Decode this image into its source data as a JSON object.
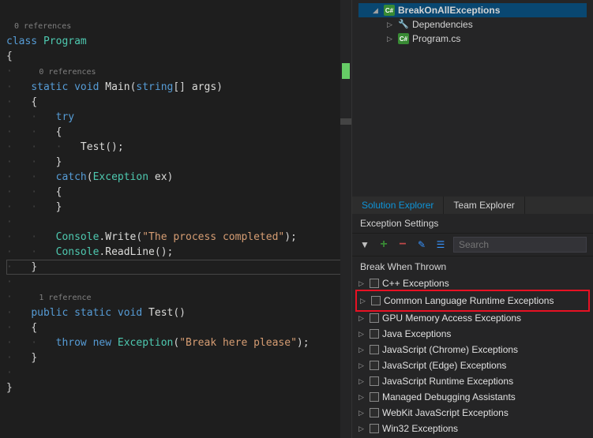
{
  "editor": {
    "codelens_class": "0 references",
    "codelens_main": "0 references",
    "codelens_test": "1 reference",
    "tokens": {
      "class": "class",
      "program": "Program",
      "static": "static",
      "void": "void",
      "main": "Main",
      "string_arr": "string",
      "args": "args",
      "try": "try",
      "test_call": "Test",
      "catch": "catch",
      "exception": "Exception",
      "ex": "ex",
      "console": "Console",
      "write": "Write",
      "readline": "ReadLine",
      "str1": "\"The process completed\"",
      "public": "public",
      "test": "Test",
      "throw": "throw",
      "new": "new",
      "str2": "\"Break here please\""
    }
  },
  "solution": {
    "project": "BreakOnAllExceptions",
    "deps": "Dependencies",
    "file1": "Program.cs",
    "cs_badge": "C#"
  },
  "tabs": {
    "solution_explorer": "Solution Explorer",
    "team_explorer": "Team Explorer"
  },
  "exception_panel": {
    "title": "Exception Settings",
    "search_placeholder": "Search",
    "section": "Break When Thrown",
    "items": [
      "C++ Exceptions",
      "Common Language Runtime Exceptions",
      "GPU Memory Access Exceptions",
      "Java Exceptions",
      "JavaScript (Chrome) Exceptions",
      "JavaScript (Edge) Exceptions",
      "JavaScript Runtime Exceptions",
      "Managed Debugging Assistants",
      "WebKit JavaScript Exceptions",
      "Win32 Exceptions"
    ]
  }
}
